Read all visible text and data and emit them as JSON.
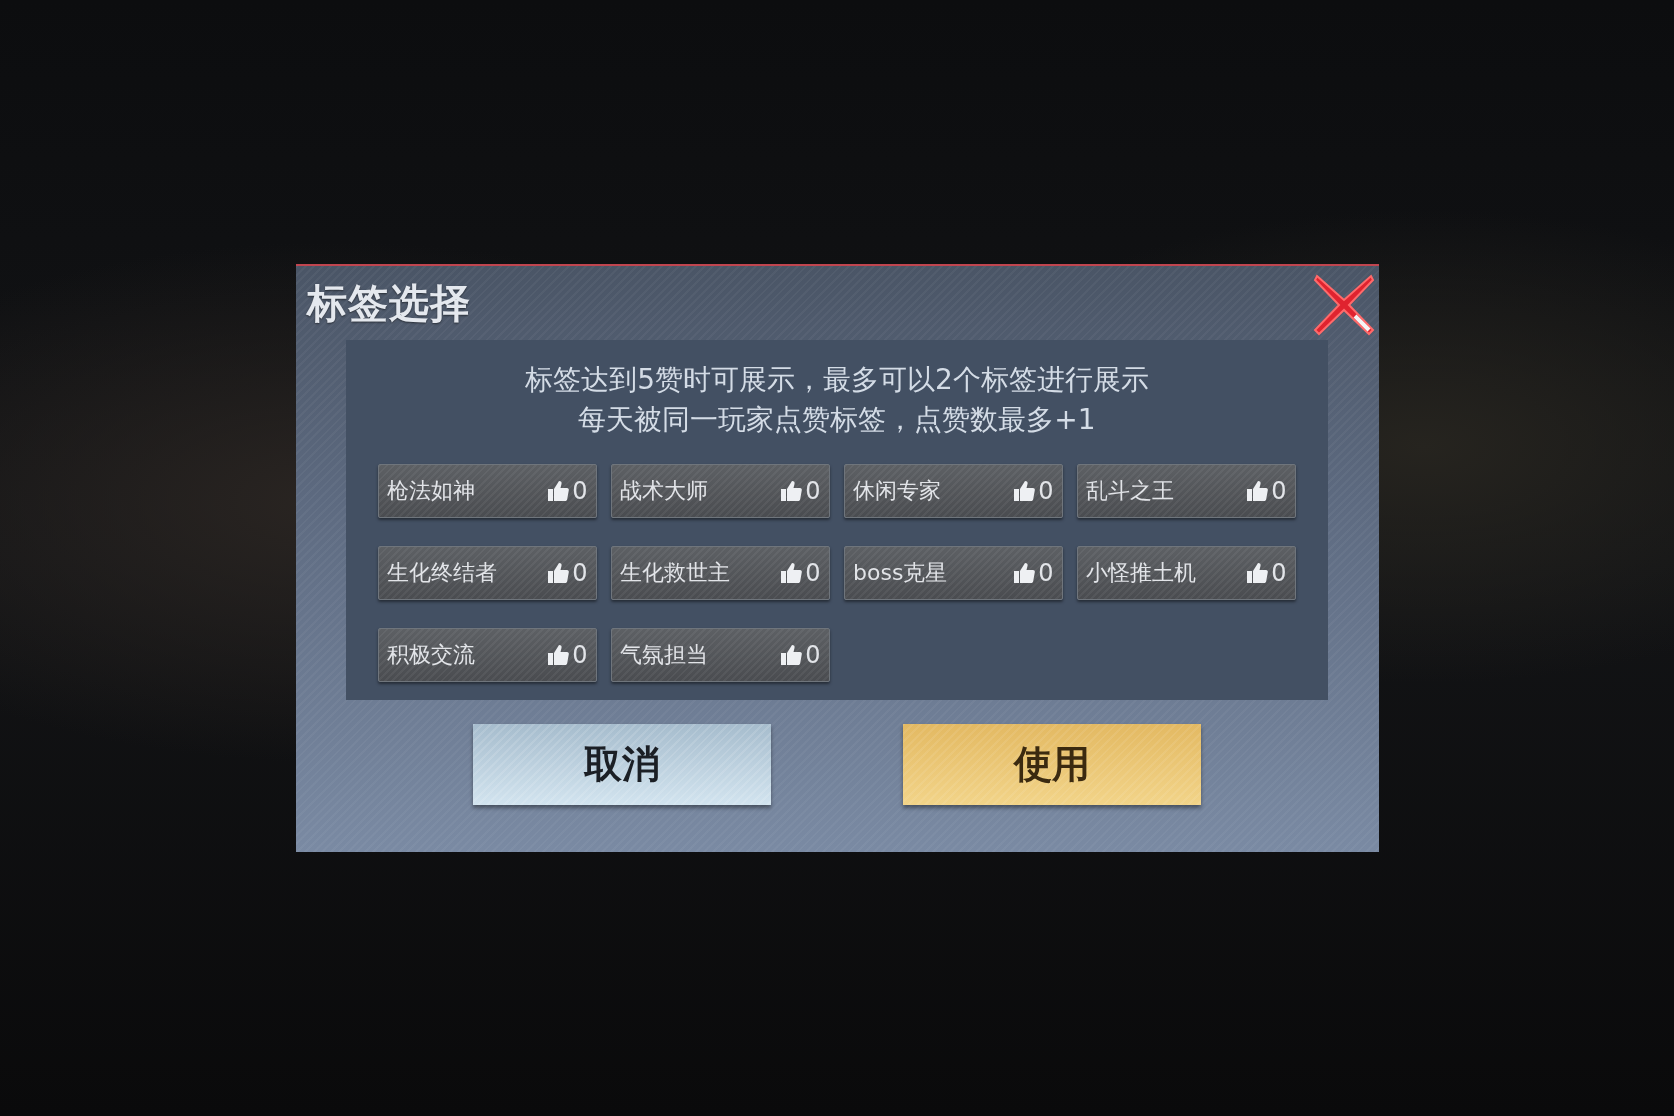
{
  "dialog": {
    "title": "标签选择",
    "info": [
      "标签达到5赞时可展示，最多可以2个标签进行展示",
      "每天被同一玩家点赞标签，点赞数最多+1"
    ],
    "tags": [
      {
        "name": "枪法如神",
        "likes": "0"
      },
      {
        "name": "战术大师",
        "likes": "0"
      },
      {
        "name": "休闲专家",
        "likes": "0"
      },
      {
        "name": "乱斗之王",
        "likes": "0"
      },
      {
        "name": "生化终结者",
        "likes": "0"
      },
      {
        "name": "生化救世主",
        "likes": "0"
      },
      {
        "name": "boss克星",
        "likes": "0"
      },
      {
        "name": "小怪推土机",
        "likes": "0"
      },
      {
        "name": "积极交流",
        "likes": "0"
      },
      {
        "name": "气氛担当",
        "likes": "0"
      }
    ],
    "buttons": [
      {
        "label": "取消",
        "kind": "cancel"
      },
      {
        "label": "使用",
        "kind": "confirm"
      }
    ]
  }
}
